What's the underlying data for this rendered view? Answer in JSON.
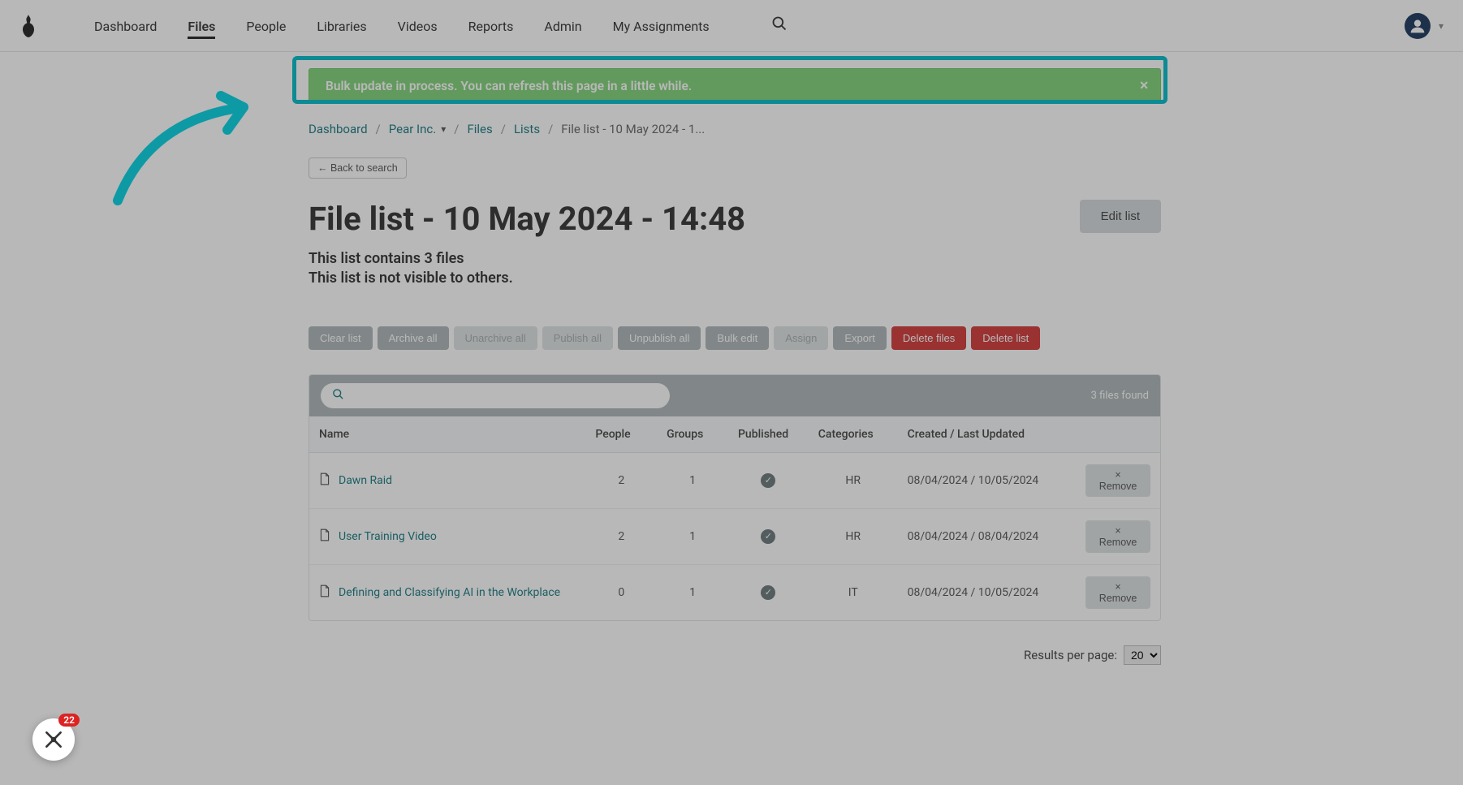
{
  "nav": {
    "items": [
      "Dashboard",
      "Files",
      "People",
      "Libraries",
      "Videos",
      "Reports",
      "Admin",
      "My Assignments"
    ],
    "active_index": 1
  },
  "alert": {
    "text": "Bulk update in process. You can refresh this page in a little while."
  },
  "breadcrumb": {
    "dashboard": "Dashboard",
    "org": "Pear Inc.",
    "files": "Files",
    "lists": "Lists",
    "current": "File list - 10 May 2024 - 1..."
  },
  "back_btn": "← Back to search",
  "page": {
    "title": "File list - 10 May 2024 - 14:48",
    "subtitle_line1": "This list contains 3 files",
    "subtitle_line2": "This list is not visible to others.",
    "edit_btn": "Edit list"
  },
  "actions": {
    "clear": "Clear list",
    "archive": "Archive all",
    "unarchive": "Unarchive all",
    "publish": "Publish all",
    "unpublish": "Unpublish all",
    "bulkedit": "Bulk edit",
    "assign": "Assign",
    "export": "Export",
    "delete_files": "Delete files",
    "delete_list": "Delete list"
  },
  "table": {
    "found_text": "3 files found",
    "search_placeholder": "",
    "columns": {
      "name": "Name",
      "people": "People",
      "groups": "Groups",
      "published": "Published",
      "categories": "Categories",
      "dates": "Created / Last Updated"
    },
    "rows": [
      {
        "name": "Dawn Raid",
        "people": "2",
        "groups": "1",
        "category": "HR",
        "dates": "08/04/2024 / 10/05/2024"
      },
      {
        "name": "User Training Video",
        "people": "2",
        "groups": "1",
        "category": "HR",
        "dates": "08/04/2024 / 08/04/2024"
      },
      {
        "name": "Defining and Classifying AI in the Workplace",
        "people": "0",
        "groups": "1",
        "category": "IT",
        "dates": "08/04/2024 / 10/05/2024"
      }
    ],
    "remove_label": "Remove"
  },
  "pager": {
    "label": "Results per page:",
    "value": "20"
  },
  "chat_badge": "22"
}
